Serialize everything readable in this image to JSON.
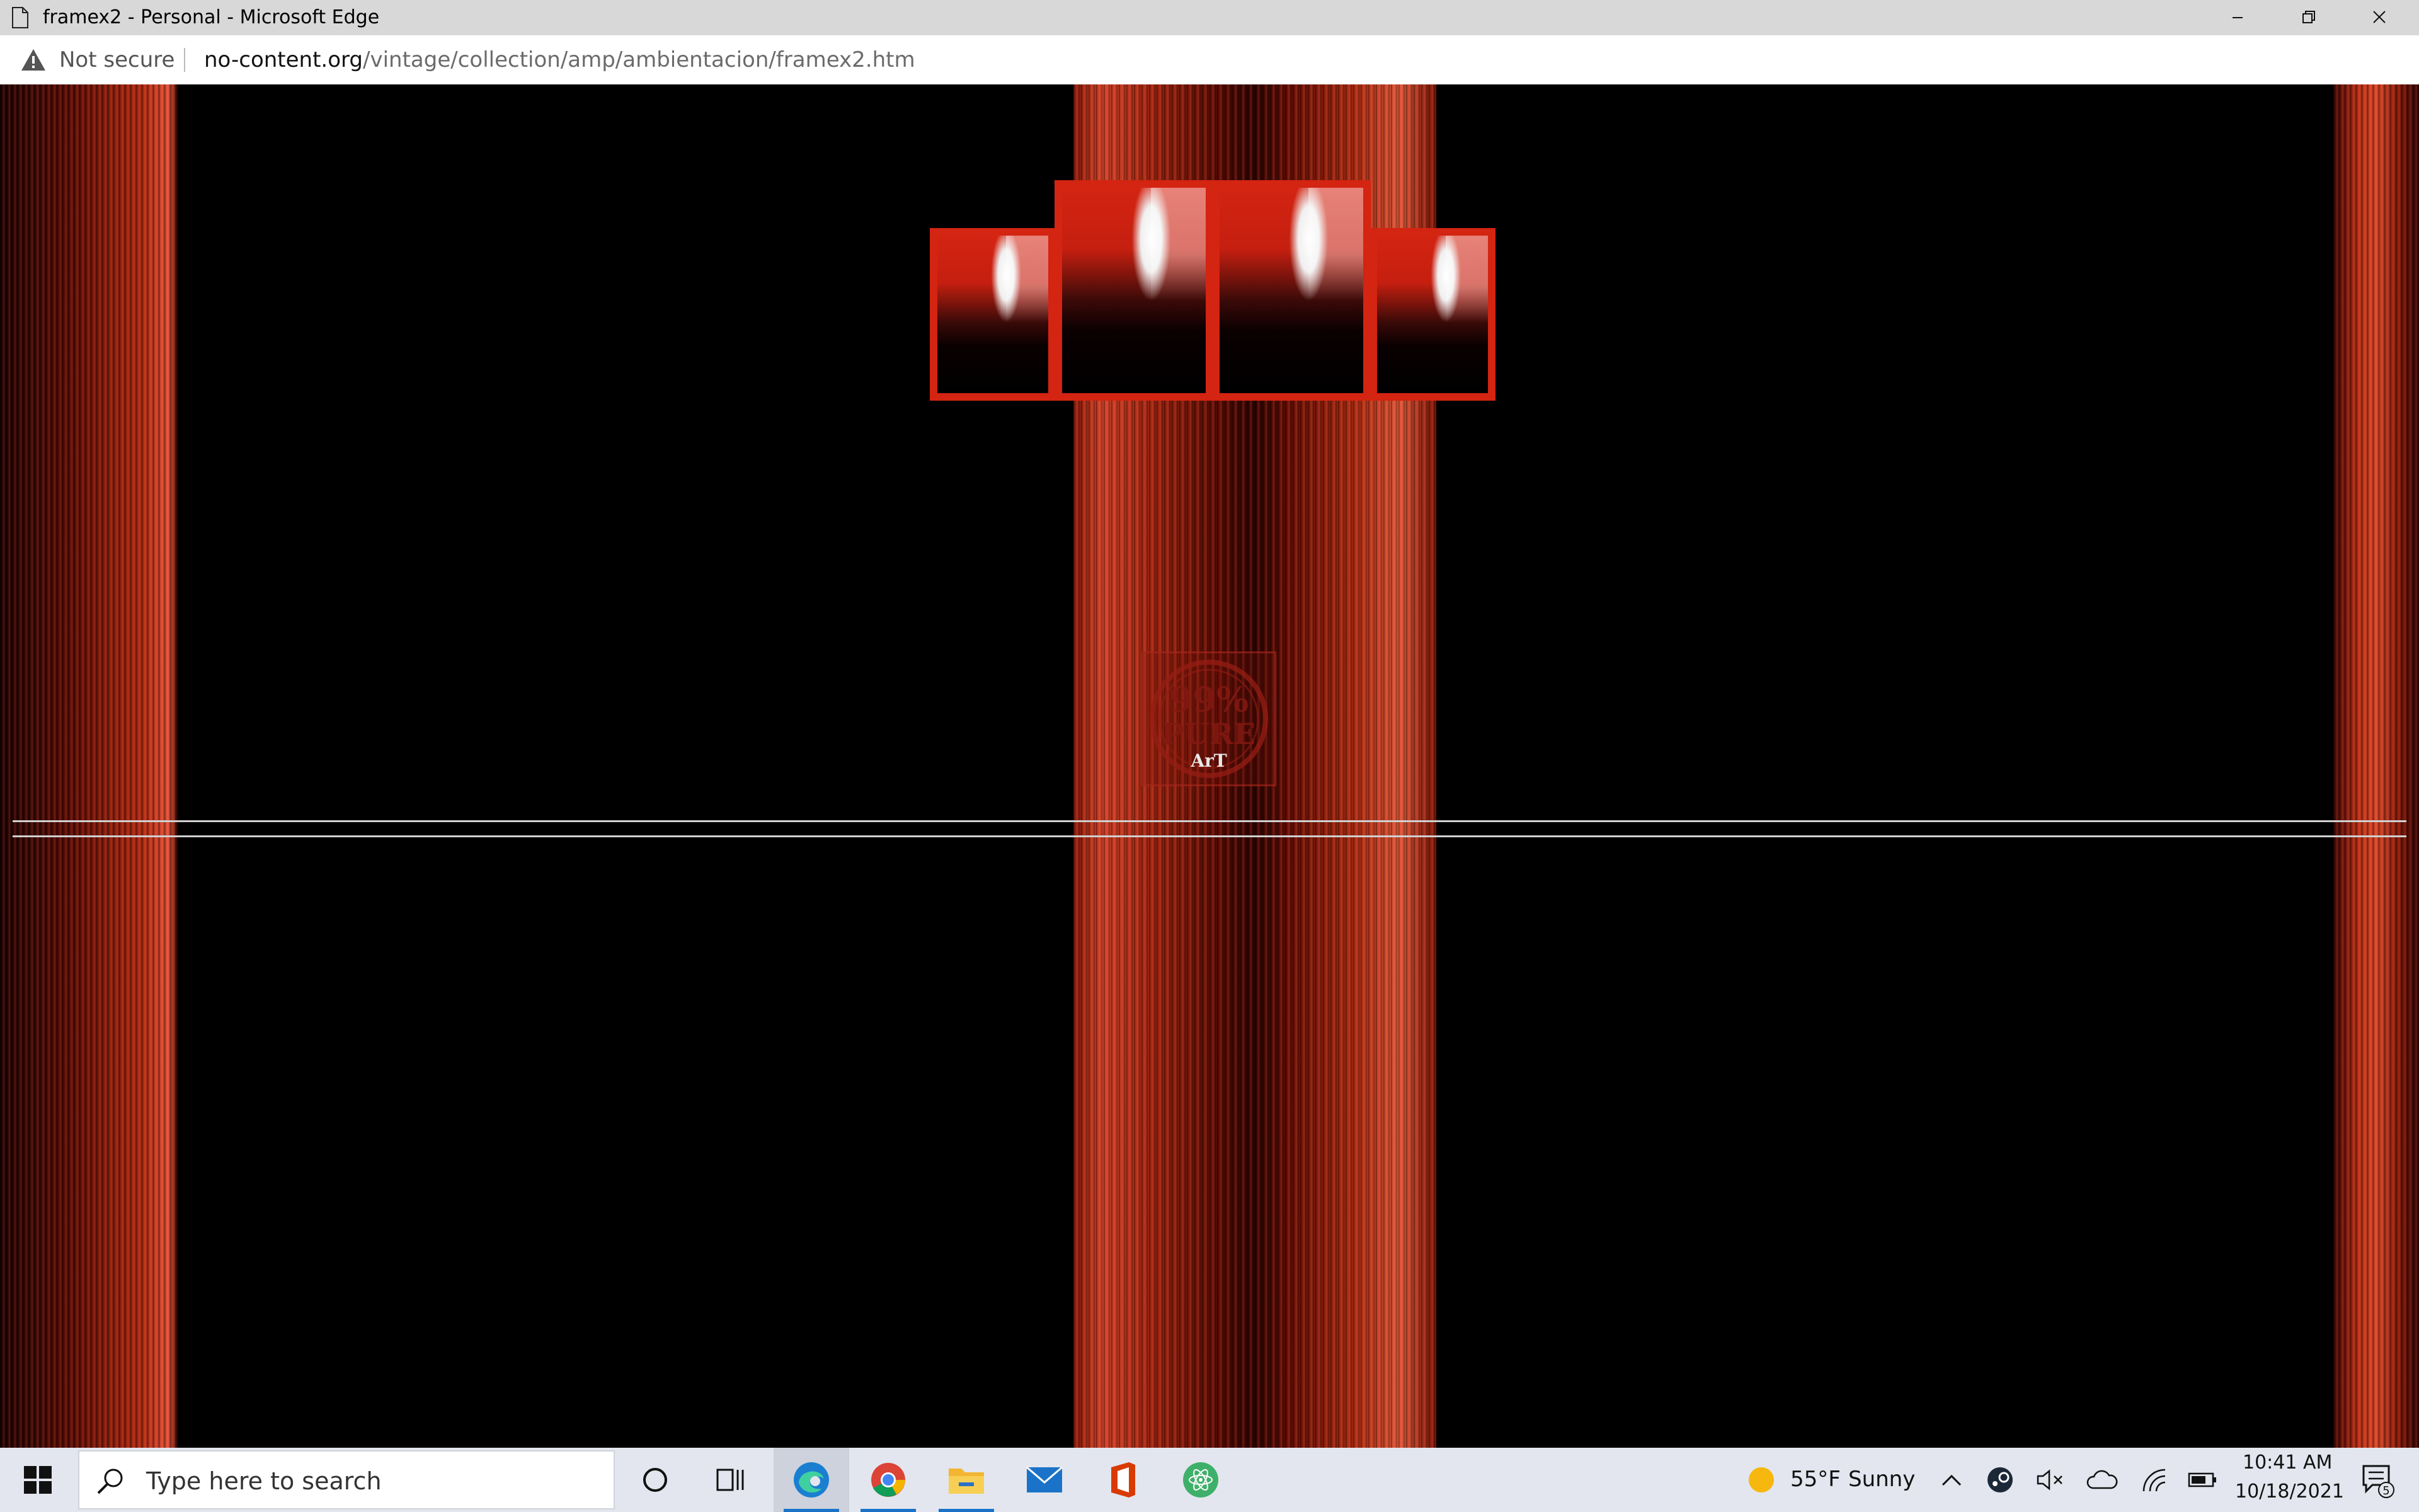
{
  "window": {
    "title": "framex2 - Personal - Microsoft Edge",
    "minimize_icon": "minimize-icon",
    "restore_icon": "restore-icon",
    "close_icon": "close-icon"
  },
  "address_bar": {
    "security_label": "Not secure",
    "url_host": "no-content.org",
    "url_path": "/vintage/collection/amp/ambientacion/framex2.htm"
  },
  "page": {
    "background": "#000000",
    "curtain_color": "#c23016",
    "frame_color": "#d42412",
    "stamp": {
      "line1": "99%",
      "line2": "PURE",
      "line3": "ArT"
    }
  },
  "taskbar": {
    "search_placeholder": "Type here to search",
    "weather_temp": "55°F",
    "weather_desc": "Sunny",
    "time": "10:41 AM",
    "date": "10/18/2021",
    "notification_count": "5",
    "apps": [
      "edge",
      "chrome",
      "file-explorer",
      "mail",
      "office",
      "atom"
    ]
  }
}
